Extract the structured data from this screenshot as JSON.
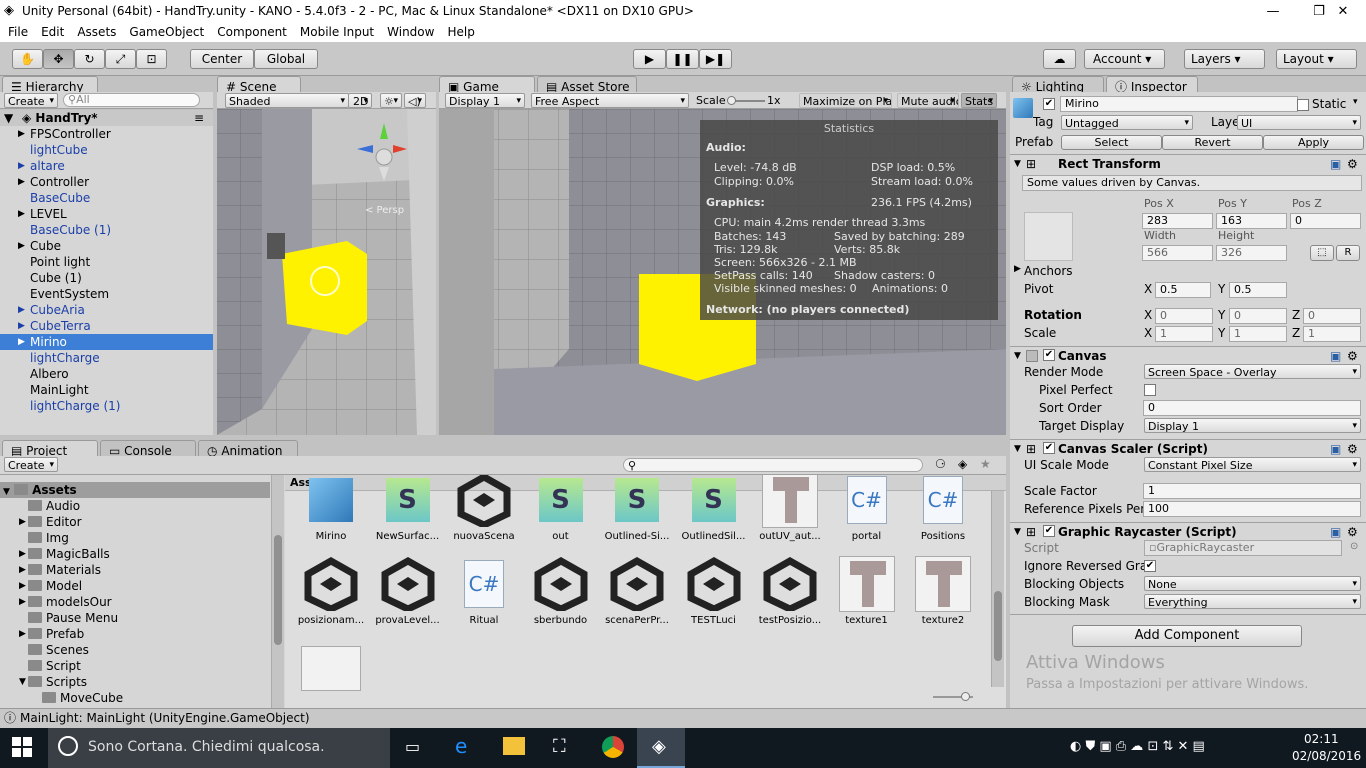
{
  "window": {
    "title": "Unity Personal (64bit) - HandTry.unity - KANO - 5.4.0f3 - 2 - PC, Mac & Linux Standalone* <DX11 on DX10 GPU>"
  },
  "menu": [
    "File",
    "Edit",
    "Assets",
    "GameObject",
    "Component",
    "Mobile Input",
    "Window",
    "Help"
  ],
  "toolbar": {
    "center": "Center",
    "global": "Global",
    "account": "Account",
    "layers": "Layers",
    "layout": "Layout"
  },
  "hierarchy": {
    "tab": "Hierarchy",
    "create": "Create",
    "search_placeholder": "All",
    "scene": "HandTry*",
    "items": [
      {
        "label": "FPSController",
        "arrow": "▶",
        "blue": false
      },
      {
        "label": "lightCube",
        "arrow": "",
        "blue": true
      },
      {
        "label": "altare",
        "arrow": "▶",
        "blue": true
      },
      {
        "label": "Controller",
        "arrow": "▶",
        "blue": false
      },
      {
        "label": "BaseCube",
        "arrow": "",
        "blue": true
      },
      {
        "label": "LEVEL",
        "arrow": "▶",
        "blue": false
      },
      {
        "label": "BaseCube (1)",
        "arrow": "",
        "blue": true
      },
      {
        "label": "Cube",
        "arrow": "▶",
        "blue": false
      },
      {
        "label": "Point light",
        "arrow": "",
        "blue": false
      },
      {
        "label": "Cube (1)",
        "arrow": "",
        "blue": false
      },
      {
        "label": "EventSystem",
        "arrow": "",
        "blue": false
      },
      {
        "label": "CubeAria",
        "arrow": "▶",
        "blue": true
      },
      {
        "label": "CubeTerra",
        "arrow": "▶",
        "blue": true
      },
      {
        "label": "Mirino",
        "arrow": "▶",
        "blue": false
      },
      {
        "label": "lightCharge",
        "arrow": "",
        "blue": true
      },
      {
        "label": "Albero",
        "arrow": "",
        "blue": false
      },
      {
        "label": "MainLight",
        "arrow": "",
        "blue": false
      },
      {
        "label": "lightCharge (1)",
        "arrow": "",
        "blue": true
      }
    ]
  },
  "scene": {
    "tab": "Scene",
    "shading": "Shaded",
    "mode2d": "2D",
    "persp": "< Persp"
  },
  "game": {
    "tab": "Game",
    "asset_store_tab": "Asset Store",
    "display": "Display 1",
    "aspect": "Free Aspect",
    "scale_label": "Scale",
    "scale_value": "1x",
    "maximize": "Maximize on Play",
    "mute": "Mute audio",
    "stats": "Stats"
  },
  "statistics": {
    "title": "Statistics",
    "audio_head": "Audio:",
    "level": "Level: -74.8 dB",
    "dsp": "DSP load: 0.5%",
    "clipping": "Clipping: 0.0%",
    "stream": "Stream load: 0.0%",
    "graphics_head": "Graphics:",
    "fps": "236.1 FPS (4.2ms)",
    "cpu": "CPU: main 4.2ms  render thread 3.3ms",
    "batches": "Batches: 143",
    "saved": "Saved by batching: 289",
    "tris": "Tris: 129.8k",
    "verts": "Verts: 85.8k",
    "screen": "Screen: 566x326 - 2.1 MB",
    "setpass": "SetPass calls: 140",
    "shadow": "Shadow casters: 0",
    "skinned": "Visible skinned meshes: 0",
    "anim": "Animations: 0",
    "network": "Network: (no players connected)"
  },
  "inspector": {
    "lighting_tab": "Lighting",
    "tab": "Inspector",
    "name": "Mirino",
    "static": "Static",
    "tag_label": "Tag",
    "tag": "Untagged",
    "layer_label": "Layer",
    "layer": "UI",
    "prefab_label": "Prefab",
    "select": "Select",
    "revert": "Revert",
    "apply": "Apply",
    "rect": {
      "title": "Rect Transform",
      "note": "Some values driven by Canvas.",
      "posx_label": "Pos X",
      "posy_label": "Pos Y",
      "posz_label": "Pos Z",
      "posx": "283",
      "posy": "163",
      "posz": "0",
      "width_label": "Width",
      "height_label": "Height",
      "width": "566",
      "height": "326",
      "r_btn": "R",
      "anchors": "Anchors",
      "pivot": "Pivot",
      "pivot_x": "0.5",
      "pivot_y": "0.5",
      "rotation": "Rotation",
      "rot_x": "0",
      "rot_y": "0",
      "rot_z": "0",
      "scale": "Scale",
      "sc_x": "1",
      "sc_y": "1",
      "sc_z": "1"
    },
    "canvas": {
      "title": "Canvas",
      "render_mode_label": "Render Mode",
      "render_mode": "Screen Space - Overlay",
      "pixel_perfect": "Pixel Perfect",
      "sort_order_label": "Sort Order",
      "sort_order": "0",
      "target_display_label": "Target Display",
      "target_display": "Display 1"
    },
    "scaler": {
      "title": "Canvas Scaler (Script)",
      "ui_scale_label": "UI Scale Mode",
      "ui_scale": "Constant Pixel Size",
      "scale_factor_label": "Scale Factor",
      "scale_factor": "1",
      "ref_ppu_label": "Reference Pixels Per",
      "ref_ppu": "100"
    },
    "raycaster": {
      "title": "Graphic Raycaster (Script)",
      "script_label": "Script",
      "script": "GraphicRaycaster",
      "ignore_label": "Ignore Reversed Gra",
      "blocking_objects_label": "Blocking Objects",
      "blocking_objects": "None",
      "blocking_mask_label": "Blocking Mask",
      "blocking_mask": "Everything"
    },
    "add_component": "Add Component",
    "watermark_1": "Attiva Windows",
    "watermark_2": "Passa a Impostazioni per attivare Windows."
  },
  "project": {
    "tab": "Project",
    "console_tab": "Console",
    "animation_tab": "Animation",
    "create": "Create",
    "breadcrumb": "Assets",
    "root": "Assets",
    "folders": [
      "Audio",
      "Editor",
      "Img",
      "MagicBalls",
      "Materials",
      "Model",
      "modelsOur",
      "Pause Menu",
      "Prefab",
      "Scenes",
      "Script",
      "Scripts"
    ],
    "subfolder": "MoveCube",
    "assets_row1": [
      "Mirino",
      "NewSurfac...",
      "nuovaScena",
      "out",
      "Outlined-Si...",
      "OutlinedSil...",
      "outUV_aut...",
      "portal",
      "Positions"
    ],
    "assets_row2": [
      "posizionam...",
      "provaLevel...",
      "Ritual",
      "sberbundo",
      "scenaPerPr...",
      "TESTLuci",
      "testPosizio...",
      "texture1",
      "texture2"
    ]
  },
  "status": {
    "text": "MainLight: MainLight (UnityEngine.GameObject)"
  },
  "taskbar": {
    "cortana": "Sono Cortana. Chiedimi qualcosa.",
    "time": "02:11",
    "date": "02/08/2016"
  }
}
